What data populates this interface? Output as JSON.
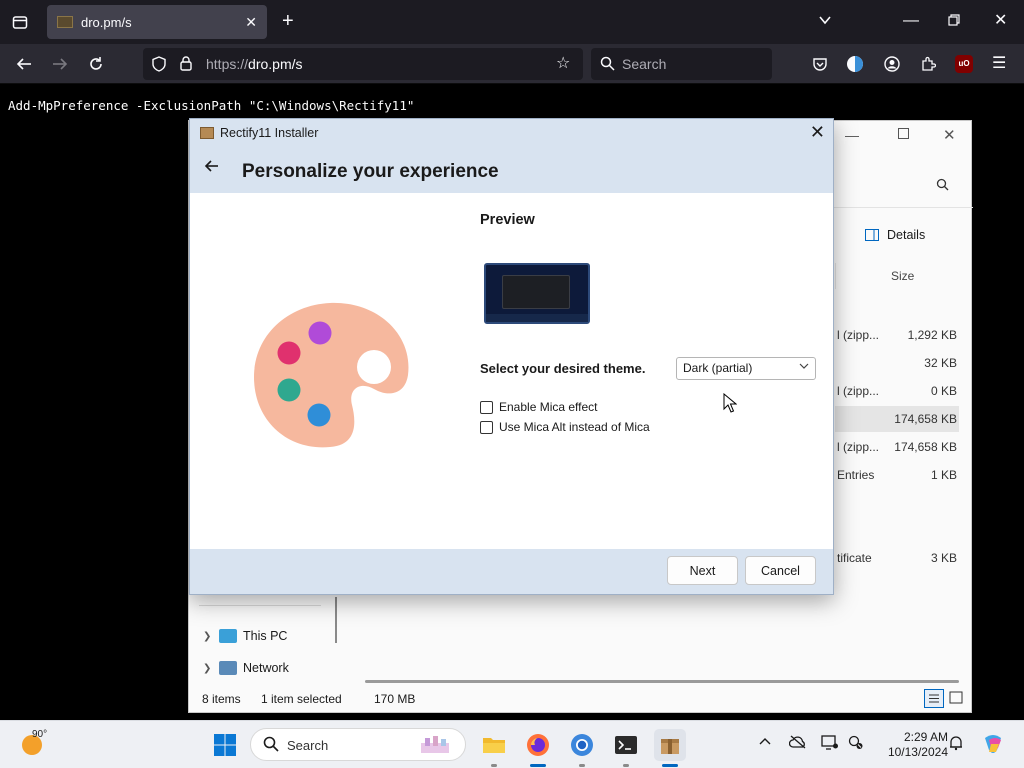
{
  "browser": {
    "tab_title": "dro.pm/s",
    "url_prefix": "https://",
    "url_host": "dro.pm/s",
    "search_placeholder": "Search",
    "ublock_badge": "uO"
  },
  "command_line": "Add-MpPreference -ExclusionPath \"C:\\Windows\\Rectify11\"",
  "installer": {
    "window_title": "Rectify11 Installer",
    "heading": "Personalize your experience",
    "preview_label": "Preview",
    "theme_label": "Select your desired theme.",
    "theme_value": "Dark (partial)",
    "options": [
      {
        "label": "Enable Mica effect",
        "checked": false
      },
      {
        "label": "Use Mica Alt instead of Mica",
        "checked": false
      }
    ],
    "next_label": "Next",
    "cancel_label": "Cancel"
  },
  "explorer": {
    "details_label": "Details",
    "size_header": "Size",
    "rows": [
      {
        "type": "l (zipp...",
        "size": "1,292 KB",
        "selected": false
      },
      {
        "type": "",
        "size": "32 KB",
        "selected": false
      },
      {
        "type": "l (zipp...",
        "size": "0 KB",
        "selected": false
      },
      {
        "type": "",
        "size": "174,658 KB",
        "selected": true
      },
      {
        "type": "l (zipp...",
        "size": "174,658 KB",
        "selected": false
      },
      {
        "type": "Entries",
        "size": "1 KB",
        "selected": false
      },
      {
        "type": "",
        "size": "",
        "selected": false
      },
      {
        "type": "tificate",
        "size": "3 KB",
        "selected": false
      }
    ],
    "nav_items": [
      {
        "label": "This PC",
        "icon": "pc-icon"
      },
      {
        "label": "Network",
        "icon": "network-icon"
      }
    ],
    "status_items": "8 items",
    "status_selected": "1 item selected",
    "status_size": "170 MB"
  },
  "taskbar": {
    "weather_temp": "90°",
    "search_label": "Search",
    "clock_time": "2:29 AM",
    "clock_date": "10/13/2024",
    "accent": "#0067c0"
  }
}
